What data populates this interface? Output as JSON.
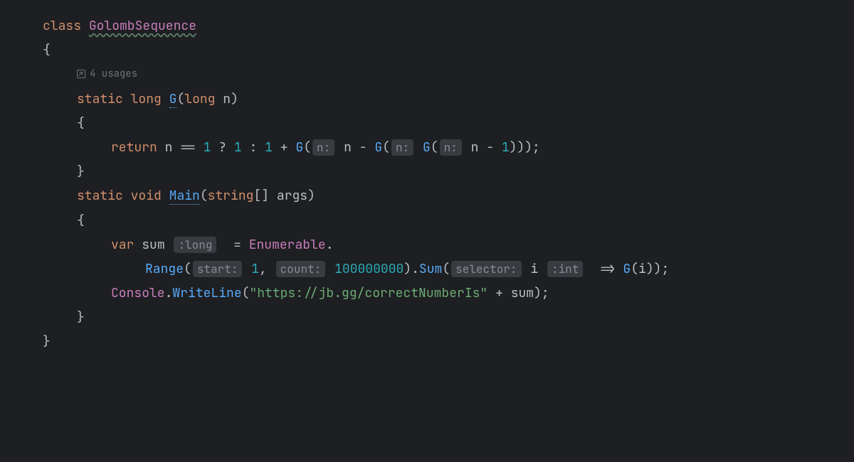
{
  "keywords": {
    "class": "class",
    "static": "static",
    "long": "long",
    "void": "void",
    "string": "string",
    "return": "return",
    "var": "var"
  },
  "class_name": "GolombSequence",
  "usages_text": "4 usages",
  "method_g": {
    "name": "G",
    "param_n": "n"
  },
  "method_main": {
    "name": "Main",
    "param_args": "args"
  },
  "logic": {
    "one": "1",
    "eq": "==",
    "ternary_q": "?",
    "ternary_c": ":",
    "plus": "+",
    "minus": "-",
    "assign": "=",
    "arrow": "=>"
  },
  "hints": {
    "n": "n:",
    "long_type": ":long",
    "start": "start:",
    "count": "count:",
    "selector": "selector:",
    "int_type": ":int"
  },
  "range_start": "1",
  "range_count": "100000000",
  "sum_var": "sum",
  "i_var": "i",
  "enumerable": "Enumerable",
  "range_method": "Range",
  "sum_method": "Sum",
  "console": "Console",
  "writeline": "WriteLine",
  "url_string": "\"https://jb.gg/correctNumberIs\"",
  "brackets": "[]"
}
